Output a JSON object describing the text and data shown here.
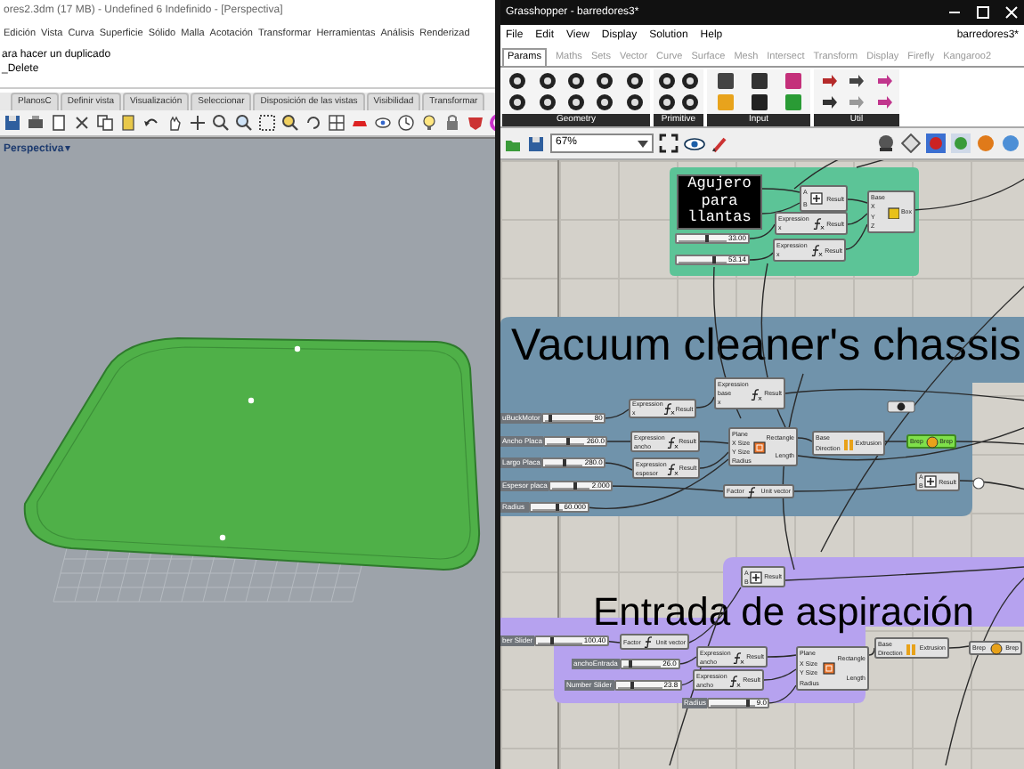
{
  "rhino": {
    "title": "ores2.3dm (17 MB) - Undefined 6 Indefinido - [Perspectiva]",
    "menu": [
      "Edición",
      "Vista",
      "Curva",
      "Superficie",
      "Sólido",
      "Malla",
      "Acotación",
      "Transformar",
      "Herramientas",
      "Análisis",
      "Renderizad"
    ],
    "command_lines": [
      "ara hacer un duplicado",
      "_Delete"
    ],
    "toolbar_tabs": [
      {
        "label": "PlanosC",
        "selected": false
      },
      {
        "label": "Definir vista",
        "selected": false
      },
      {
        "label": "Visualización",
        "selected": false
      },
      {
        "label": "Seleccionar",
        "selected": false
      },
      {
        "label": "Disposición de las vistas",
        "selected": false
      },
      {
        "label": "Visibilidad",
        "selected": false
      },
      {
        "label": "Transformar",
        "selected": false
      }
    ],
    "viewport": {
      "label": "Perspectiva",
      "caret": "▾"
    }
  },
  "grasshopper": {
    "title": "Grasshopper - barredores3*",
    "menu": [
      "File",
      "Edit",
      "View",
      "Display",
      "Solution",
      "Help"
    ],
    "document": "barredores3*",
    "tabs": [
      {
        "label": "Params",
        "selected": true
      },
      {
        "label": "Maths",
        "selected": false
      },
      {
        "label": "Sets",
        "selected": false
      },
      {
        "label": "Vector",
        "selected": false
      },
      {
        "label": "Curve",
        "selected": false
      },
      {
        "label": "Surface",
        "selected": false
      },
      {
        "label": "Mesh",
        "selected": false
      },
      {
        "label": "Intersect",
        "selected": false
      },
      {
        "label": "Transform",
        "selected": false
      },
      {
        "label": "Display",
        "selected": false
      },
      {
        "label": "Firefly",
        "selected": false
      },
      {
        "label": "Kangaroo2",
        "selected": false
      }
    ],
    "ribbon_groups": [
      "Geometry",
      "Primitive",
      "Input",
      "Util"
    ],
    "zoom": "67%",
    "canvas": {
      "groups": [
        {
          "color": "#5cc497"
        },
        {
          "title": "Vacuum cleaner's chassis",
          "color": "#7093ab"
        },
        {
          "title": "Entrada de aspiración",
          "color": "#b6a2ef"
        }
      ],
      "panel": {
        "text": "Agujero para llantas"
      },
      "sliders": [
        {
          "value": "33.00",
          "level": 0.6
        },
        {
          "value": "53.14",
          "level": 0.75
        },
        {
          "label": "uBuckMotor",
          "value": "80",
          "level": 0.1
        },
        {
          "label": "Ancho Placa",
          "value": "260.0",
          "level": 0.55
        },
        {
          "label": "Largo Placa",
          "value": "280.0",
          "level": 0.5
        },
        {
          "label": "Espesor placa",
          "value": "2.000",
          "level": 0.6
        },
        {
          "label": "Radius",
          "value": "60.000",
          "level": 0.85
        },
        {
          "label": "ber Slider",
          "value": "100.40",
          "level": 0.3
        },
        {
          "label": "anchoEntrada",
          "value": "26.0",
          "level": 0.2
        },
        {
          "label": "Number Slider",
          "value": "23.8",
          "level": 0.35
        },
        {
          "label": "Radius",
          "value": "9.0",
          "level": 0.85
        }
      ],
      "components": [
        {
          "kind": "addition",
          "inputs": [
            "A",
            "B"
          ],
          "outputs": [
            "Result"
          ],
          "selected": false
        },
        {
          "kind": "expression",
          "title": "Expression",
          "inputs": [
            "x"
          ],
          "outputs": [
            "Result"
          ],
          "selected": false
        },
        {
          "kind": "expression",
          "title": "Expression",
          "inputs": [
            "x"
          ],
          "outputs": [
            "Result"
          ],
          "selected": false
        },
        {
          "kind": "box",
          "title": "Base",
          "inputs": [
            "X",
            "Y",
            "Z"
          ],
          "outputs": [
            "Box"
          ],
          "selected": false
        },
        {
          "kind": "expression",
          "title": "Expression",
          "inputs": [
            "x"
          ],
          "outputs": [
            "Result"
          ],
          "selected": false
        },
        {
          "kind": "expression",
          "title": "Expression",
          "inputs": [
            "base",
            "x"
          ],
          "outputs": [
            "Result"
          ],
          "selected": false
        },
        {
          "kind": "expression",
          "title": "Expression",
          "inputs": [
            "ancho"
          ],
          "outputs": [
            "Result"
          ],
          "selected": false
        },
        {
          "kind": "expression",
          "title": "Expression",
          "inputs": [
            "espesor"
          ],
          "outputs": [
            "Result"
          ],
          "selected": false
        },
        {
          "kind": "rectangle",
          "inputs": [
            "Plane",
            "X Size",
            "Y Size",
            "Radius"
          ],
          "outputs": [
            "Rectangle",
            "Length"
          ],
          "selected": false
        },
        {
          "kind": "extrude",
          "inputs": [
            "Base",
            "Direction"
          ],
          "outputs": [
            "Extrusion"
          ],
          "selected": false
        },
        {
          "kind": "cap",
          "inputs": [
            "Brep"
          ],
          "outputs": [
            "Brep"
          ],
          "selected": true
        },
        {
          "kind": "factor",
          "inputs": [
            "Factor"
          ],
          "outputs": [
            "Unit vector"
          ],
          "selected": false
        },
        {
          "kind": "addition",
          "inputs": [
            "A",
            "B"
          ],
          "outputs": [
            "Result"
          ],
          "selected": false
        },
        {
          "kind": "addition",
          "inputs": [
            "A",
            "B"
          ],
          "outputs": [
            "Result"
          ],
          "selected": false
        },
        {
          "kind": "factor",
          "inputs": [
            "Factor"
          ],
          "outputs": [
            "Unit vector"
          ],
          "selected": false
        },
        {
          "kind": "expression",
          "title": "Expression",
          "inputs": [
            "ancho"
          ],
          "outputs": [
            "Result"
          ],
          "selected": false
        },
        {
          "kind": "expression",
          "title": "Expression",
          "inputs": [
            "ancho"
          ],
          "outputs": [
            "Result"
          ],
          "selected": false
        },
        {
          "kind": "rectangle",
          "inputs": [
            "Plane",
            "X Size",
            "Y Size",
            "Radius"
          ],
          "outputs": [
            "Rectangle",
            "Length"
          ],
          "selected": false
        },
        {
          "kind": "extrude",
          "inputs": [
            "Base",
            "Direction"
          ],
          "outputs": [
            "Extrusion"
          ],
          "selected": false
        },
        {
          "kind": "cap",
          "inputs": [
            "Brep"
          ],
          "outputs": [
            "Brep"
          ],
          "selected": false
        }
      ]
    }
  }
}
